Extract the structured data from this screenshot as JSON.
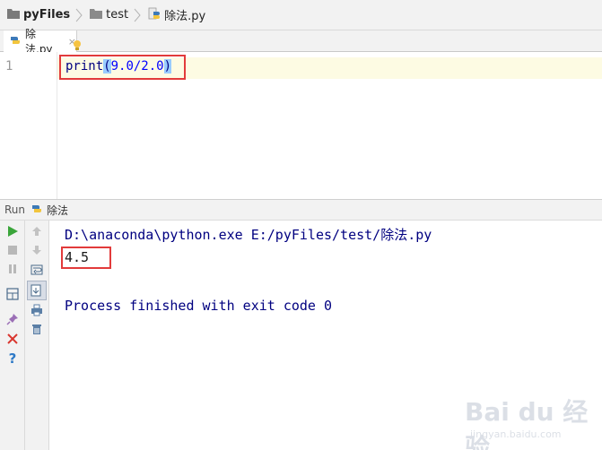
{
  "breadcrumb": {
    "project": "pyFiles",
    "folder": "test",
    "file": "除法.py"
  },
  "tabs": [
    {
      "label": "除法.py",
      "close": "×"
    }
  ],
  "editor": {
    "line_number": "1",
    "code_prefix": "print",
    "code_open_paren": "(",
    "code_args": "9.0/2.0",
    "code_close_paren": ")"
  },
  "run_panel": {
    "title": "Run",
    "config_name": "除法",
    "command_line": "D:\\anaconda\\python.exe E:/pyFiles/test/除法.py",
    "output": "4.5",
    "exit_message": "Process finished with exit code 0"
  },
  "toolbar_icons": [
    "run-icon",
    "stop-icon",
    "pause-icon",
    "layout-icon",
    "pin-icon",
    "close-icon",
    "help-icon",
    "up-arrow-icon",
    "down-arrow-icon",
    "soft-wrap-icon",
    "scroll-to-end-icon",
    "print-icon",
    "trash-icon"
  ],
  "watermark": {
    "brand": "Bai du 经验",
    "url": "jingyan.baidu.com"
  },
  "colors": {
    "highlight_box": "#e23b3b",
    "console_text": "#000080",
    "run_green": "#3aa53a"
  }
}
